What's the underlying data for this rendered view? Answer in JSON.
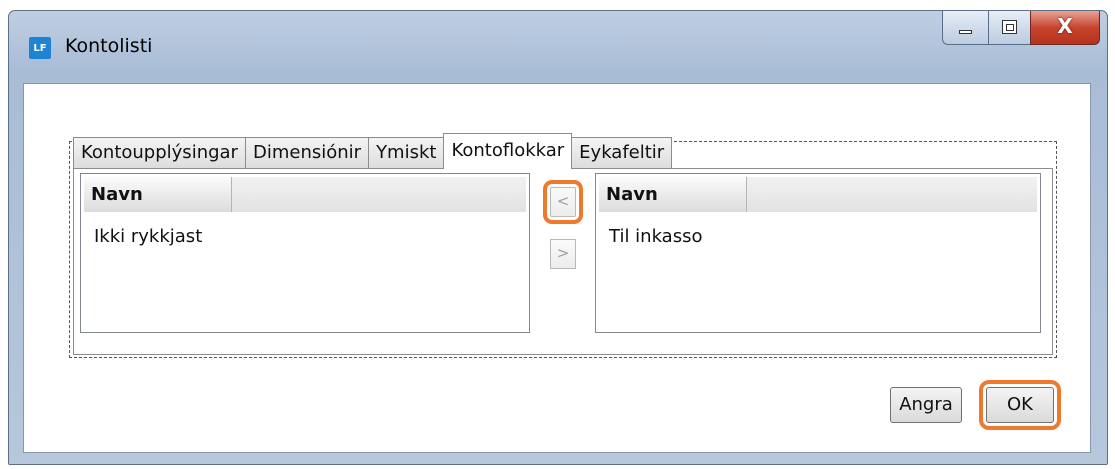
{
  "window": {
    "icon_text": "LF",
    "title": "Kontolisti",
    "close_glyph": "X"
  },
  "tabs": [
    {
      "label": "Kontoupplýsingar"
    },
    {
      "label": "Dimensiónir"
    },
    {
      "label": "Ymiskt"
    },
    {
      "label": "Kontoflokkar",
      "active": true
    },
    {
      "label": "Eykafeltir"
    }
  ],
  "available_list": {
    "column_header": "Navn",
    "items": [
      "Ikki rykkjast"
    ]
  },
  "selected_list": {
    "column_header": "Navn",
    "items": [
      "Til inkasso"
    ]
  },
  "move_buttons": {
    "left_label": "<",
    "right_label": ">"
  },
  "footer": {
    "cancel_label": "Angra",
    "ok_label": "OK"
  },
  "colors": {
    "highlight": "#ef7a2e",
    "titlebar": "#bfcfe3",
    "close_button": "#c6452f",
    "app_icon": "#1e83d4"
  }
}
